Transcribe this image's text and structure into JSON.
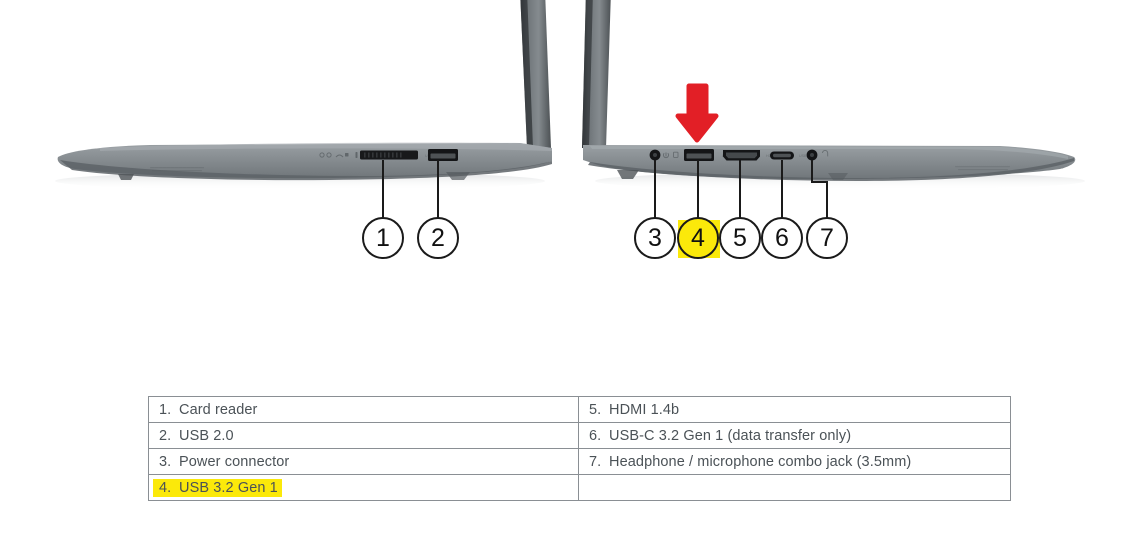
{
  "document": {
    "type": "laptop-port-identification-diagram",
    "background_color": "#ffffff"
  },
  "illustration": {
    "left_device": {
      "name": "laptop-left-side-view",
      "ports": [
        {
          "id": 1,
          "name": "card-reader-slot",
          "label": "1"
        },
        {
          "id": 2,
          "name": "usb-2-0-port",
          "label": "2"
        }
      ]
    },
    "right_device": {
      "name": "laptop-right-side-view",
      "ports": [
        {
          "id": 3,
          "name": "power-connector-port",
          "label": "3"
        },
        {
          "id": 4,
          "name": "usb-3-2-gen-1-port",
          "label": "4",
          "highlighted": true
        },
        {
          "id": 5,
          "name": "hdmi-port",
          "label": "5"
        },
        {
          "id": 6,
          "name": "usb-c-port",
          "label": "6"
        },
        {
          "id": 7,
          "name": "headphone-microphone-jack",
          "label": "7"
        }
      ]
    },
    "annotation": {
      "name": "red-down-arrow",
      "points_at": "4",
      "color": "#e21f26"
    }
  },
  "callouts": [
    {
      "label": "1"
    },
    {
      "label": "2"
    },
    {
      "label": "3"
    },
    {
      "label": "4"
    },
    {
      "label": "5"
    },
    {
      "label": "6"
    },
    {
      "label": "7"
    }
  ],
  "legend": {
    "highlight_color": "#fbe90a",
    "border_color": "#8a8f94",
    "text_color": "#4b5257",
    "rows": [
      {
        "left": {
          "num": "1.",
          "text": "Card reader",
          "highlight": false
        },
        "right": {
          "num": "5.",
          "text": "HDMI 1.4b",
          "highlight": false
        }
      },
      {
        "left": {
          "num": "2.",
          "text": "USB 2.0",
          "highlight": false
        },
        "right": {
          "num": "6.",
          "text": "USB-C 3.2 Gen 1 (data transfer only)",
          "highlight": false
        }
      },
      {
        "left": {
          "num": "3.",
          "text": "Power connector",
          "highlight": false
        },
        "right": {
          "num": "7.",
          "text": "Headphone / microphone combo jack (3.5mm)",
          "highlight": false
        }
      },
      {
        "left": {
          "num": "4.",
          "text": "USB 3.2 Gen 1",
          "highlight": true
        },
        "right": {
          "num": "",
          "text": "",
          "highlight": false
        }
      }
    ]
  }
}
